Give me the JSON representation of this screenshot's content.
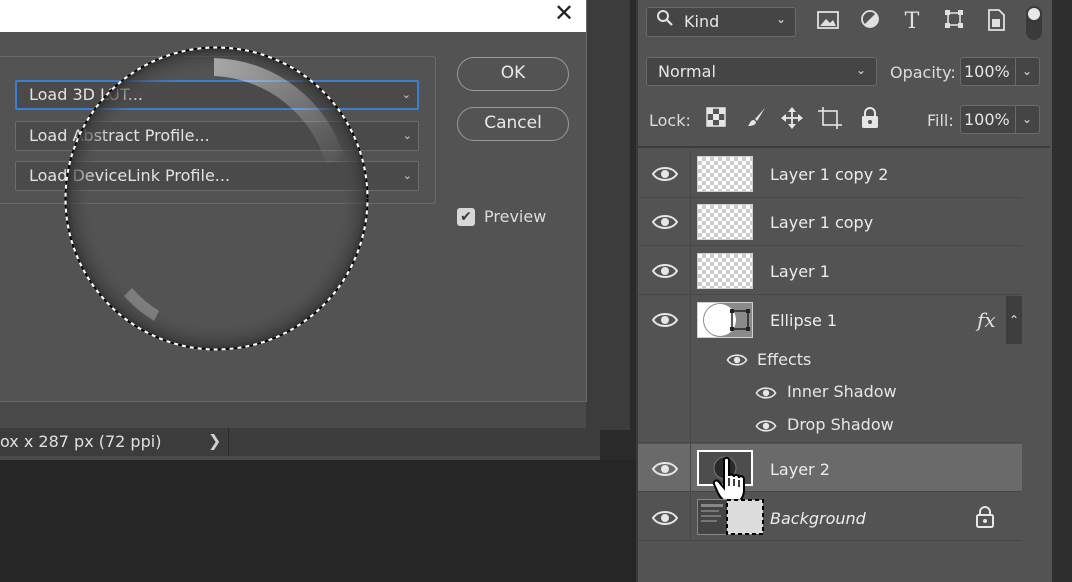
{
  "dialog": {
    "load_options": [
      "Load 3D LUT...",
      "Load Abstract Profile...",
      "Load DeviceLink Profile..."
    ],
    "ok_label": "OK",
    "cancel_label": "Cancel",
    "preview_label": "Preview",
    "preview_checked": true,
    "close_glyph": "✕"
  },
  "status_bar": {
    "text": "ox x 287 px (72 ppi)",
    "arrow": "❯"
  },
  "layers_panel": {
    "filter_kind": "Kind",
    "filter_icons": [
      "image-filter-icon",
      "adjustment-filter-icon",
      "type-filter-icon",
      "shape-filter-icon",
      "smart-object-filter-icon"
    ],
    "blend_mode": "Normal",
    "opacity_label": "Opacity:",
    "opacity": "100%",
    "lock_label": "Lock:",
    "lock_icons": [
      "lock-transparent-pixels-icon",
      "lock-image-pixels-icon",
      "lock-position-icon",
      "lock-artboard-icon",
      "lock-all-icon"
    ],
    "fill_label": "Fill:",
    "fill": "100%",
    "layers": [
      {
        "name": "Layer 1 copy 2",
        "visible": true
      },
      {
        "name": "Layer 1 copy",
        "visible": true
      },
      {
        "name": "Layer 1",
        "visible": true
      },
      {
        "name": "Ellipse 1",
        "visible": true,
        "fx": "fx"
      },
      {
        "name": "Layer 2",
        "visible": true,
        "selected": true
      },
      {
        "name": "Background",
        "visible": true,
        "locked": true
      }
    ],
    "effects_label": "Effects",
    "effects": [
      "Inner Shadow",
      "Drop Shadow"
    ]
  }
}
